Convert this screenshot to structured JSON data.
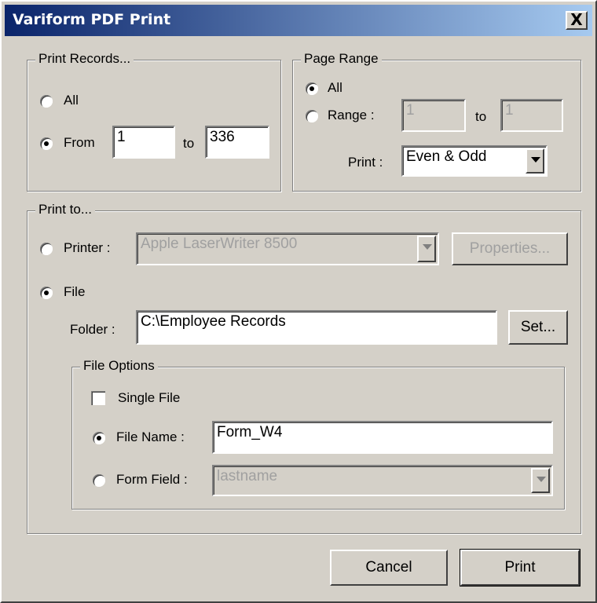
{
  "window": {
    "title": "Variform PDF Print",
    "close_label": "X"
  },
  "print_records": {
    "legend": "Print Records...",
    "all_label": "All",
    "from_label": "From",
    "from_value": "1",
    "to_label": "to",
    "to_value": "336",
    "selected": "From"
  },
  "page_range": {
    "legend": "Page Range",
    "all_label": "All",
    "range_label": "Range :",
    "range_from": "1",
    "to_label": "to",
    "range_to": "1",
    "print_label": "Print :",
    "print_value": "Even & Odd",
    "selected": "All"
  },
  "print_to": {
    "legend": "Print to...",
    "printer_label": "Printer :",
    "printer_value": "Apple LaserWriter 8500",
    "properties_label": "Properties...",
    "file_label": "File",
    "folder_label": "Folder :",
    "folder_value": "C:\\Employee Records",
    "set_label": "Set...",
    "selected": "File"
  },
  "file_options": {
    "legend": "File Options",
    "single_file_label": "Single File",
    "single_file_checked": false,
    "file_name_label": "File Name :",
    "file_name_value": "Form_W4",
    "form_field_label": "Form Field :",
    "form_field_value": "lastname",
    "selected": "File Name"
  },
  "buttons": {
    "cancel": "Cancel",
    "print": "Print"
  }
}
